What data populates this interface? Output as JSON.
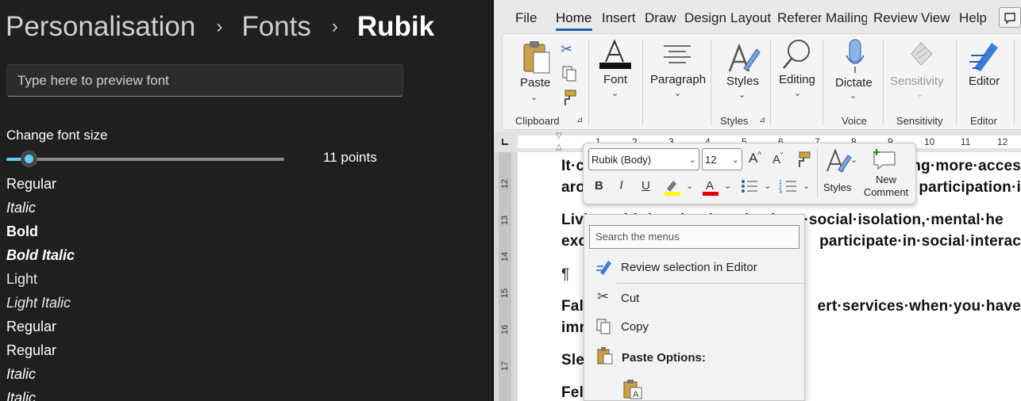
{
  "settings": {
    "breadcrumb": [
      "Personalisation",
      "Fonts",
      "Rubik"
    ],
    "breadcrumb_separator": "›",
    "preview_placeholder": "Type here to preview font",
    "size_label": "Change font size",
    "size_value": "11 points",
    "size_fraction": 0.08,
    "styles": [
      {
        "label": "Regular",
        "weight": "normal",
        "italic": false
      },
      {
        "label": "Italic",
        "weight": "normal",
        "italic": true
      },
      {
        "label": "Bold",
        "weight": "bold",
        "italic": false
      },
      {
        "label": "Bold Italic",
        "weight": "bold",
        "italic": true
      },
      {
        "label": "Light",
        "weight": "300",
        "italic": false
      },
      {
        "label": "Light Italic",
        "weight": "300",
        "italic": true
      },
      {
        "label": "Regular",
        "weight": "normal",
        "italic": false
      },
      {
        "label": "Regular",
        "weight": "normal",
        "italic": false
      },
      {
        "label": "Italic",
        "weight": "normal",
        "italic": true
      },
      {
        "label": "Italic",
        "weight": "normal",
        "italic": true
      }
    ]
  },
  "word": {
    "menu_tabs": [
      "File",
      "Home",
      "Insert",
      "Draw",
      "Design",
      "Layout",
      "Referen",
      "Mailing",
      "Review",
      "View",
      "Help"
    ],
    "active_tab": "Home",
    "ribbon": {
      "paste": "Paste",
      "clipboard_group": "Clipboard",
      "font": "Font",
      "paragraph": "Paragraph",
      "styles": "Styles",
      "styles_group": "Styles",
      "editing": "Editing",
      "dictate": "Dictate",
      "voice_group": "Voice",
      "sensitivity": "Sensitivity",
      "sensitivity_group": "Sensitivity",
      "editor": "Editor",
      "editor_group": "Editor"
    },
    "ruler_numbers": [
      "1",
      "2",
      "3",
      "4",
      "5",
      "6",
      "7",
      "8",
      "9",
      "10",
      "11",
      "12"
    ],
    "vruler_numbers": [
      "12",
      "13",
      "14",
      "15",
      "16",
      "17"
    ],
    "document_lines": [
      "It·c",
      "aro",
      "Living·with·hearing·loss·leads·to·social·isolation,·mental·he",
      "exc",
      "¶",
      "Fal",
      "imr",
      "Sle",
      "Fel"
    ],
    "document_line_tails": [
      "ng·more·acces",
      "participation·i",
      "",
      "participate·in·social·interac",
      "",
      "ert·services·when·you·have",
      "",
      "",
      ""
    ],
    "minibar": {
      "font_name": "Rubik (Body)",
      "font_size": "12",
      "styles": "Styles",
      "new_comment": "New Comment"
    },
    "context_menu": {
      "search_placeholder": "Search the menus",
      "review": "Review selection in Editor",
      "cut": "Cut",
      "copy": "Copy",
      "paste_options": "Paste Options:"
    },
    "colors": {
      "highlight": "#ffff00",
      "font_color": "#e00000",
      "accent": "#1a5fb4"
    }
  }
}
